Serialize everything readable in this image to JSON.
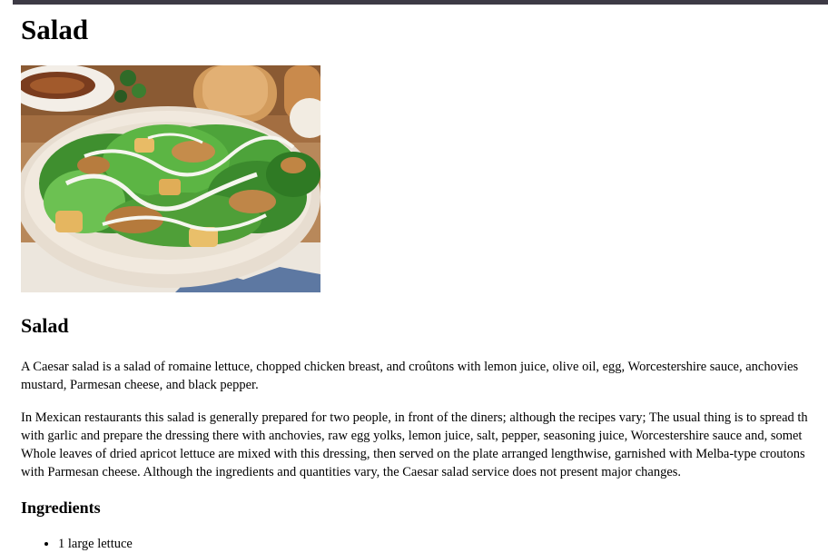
{
  "page": {
    "title": "Salad",
    "image_alt": "Caesar salad"
  },
  "section": {
    "title": "Salad",
    "paragraph1_lines": [
      "A Caesar salad is a salad of romaine lettuce, chopped chicken breast, and croûtons with lemon juice, olive oil, egg, Worcestershire sauce, anchovies",
      "mustard, Parmesan cheese, and black pepper."
    ],
    "paragraph2_lines": [
      "In Mexican restaurants this salad is generally prepared for two people, in front of the diners; although the recipes vary; The usual thing is to spread th",
      "with garlic and prepare the dressing there with anchovies, raw egg yolks, lemon juice, salt, pepper, seasoning juice, Worcestershire sauce and, somet",
      "Whole leaves of dried apricot lettuce are mixed with this dressing, then served on the plate arranged lengthwise, garnished with Melba-type croutons",
      "with Parmesan cheese. Although the ingredients and quantities vary, the Caesar salad service does not present major changes."
    ]
  },
  "ingredients": {
    "title": "Ingredients",
    "items": [
      "1 large lettuce"
    ]
  },
  "colors": {
    "topbar": "#3d3a45",
    "text": "#000000",
    "background": "#ffffff"
  }
}
